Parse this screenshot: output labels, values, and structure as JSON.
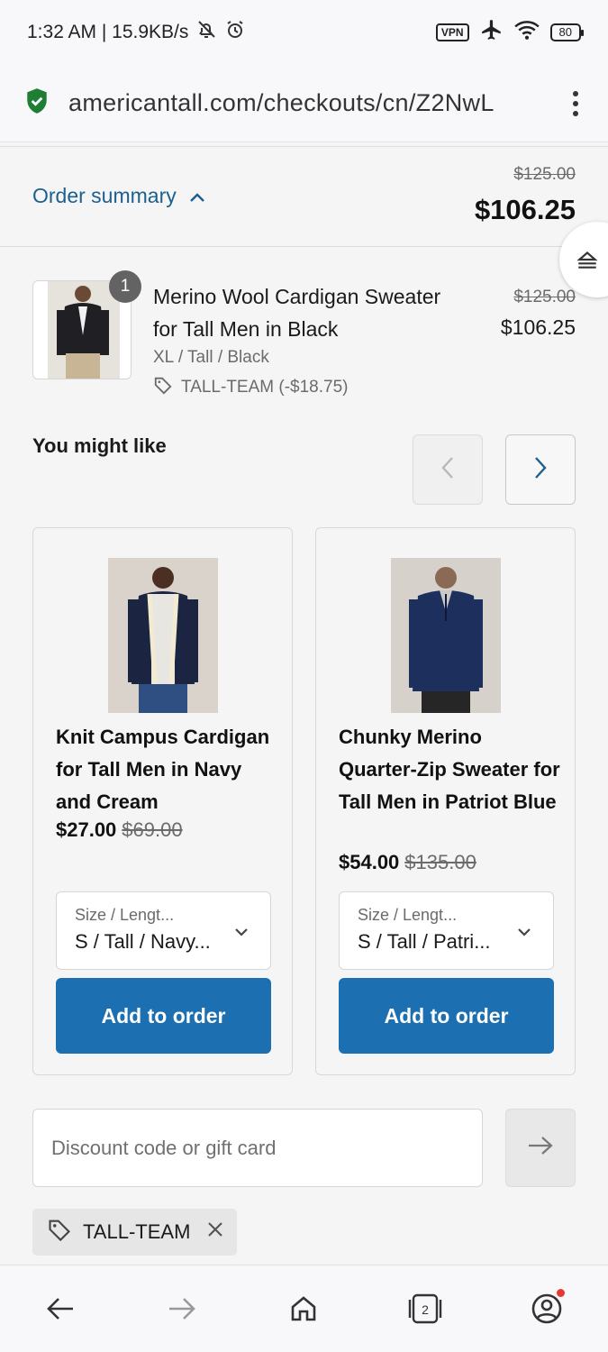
{
  "status_bar": {
    "time_speed": "1:32 AM | 15.9KB/s",
    "vpn": "VPN",
    "battery": "80"
  },
  "browser": {
    "url": "americantall.com/checkouts/cn/Z2NwL"
  },
  "summary": {
    "toggle_label": "Order summary",
    "original_total": "$125.00",
    "total": "$106.25"
  },
  "line_item": {
    "quantity": "1",
    "title": "Merino Wool Cardigan Sweater for Tall Men in Black",
    "variant": "XL / Tall / Black",
    "discount": "TALL-TEAM (-$18.75)",
    "original_price": "$125.00",
    "price": "$106.25"
  },
  "recommendations": {
    "title": "You might like",
    "items": [
      {
        "title": "Knit Campus Cardigan for Tall Men in Navy and Cream",
        "price": "$27.00",
        "original_price": "$69.00",
        "select_label": "Size / Lengt...",
        "select_value": "S / Tall / Navy...",
        "button": "Add to order"
      },
      {
        "title": "Chunky Merino Quarter-Zip Sweater for Tall Men in Patriot Blue",
        "price": "$54.00",
        "original_price": "$135.00",
        "select_label": "Size / Lengt...",
        "select_value": "S / Tall / Patri...",
        "button": "Add to order"
      }
    ]
  },
  "discount": {
    "placeholder": "Discount code or gift card",
    "applied_code": "TALL-TEAM"
  },
  "colors": {
    "accent": "#1c6fb1",
    "link": "#1d5f8f",
    "secure": "#1e7e34"
  },
  "icons": [
    "bell-off-icon",
    "alarm-icon",
    "airplane-icon",
    "wifi-icon",
    "shield-check-icon",
    "menu-kebab-icon",
    "chevron-up-icon",
    "collapse-icon",
    "tag-icon",
    "chevron-left-icon",
    "chevron-right-icon",
    "chevron-down-icon",
    "arrow-right-icon",
    "close-icon",
    "back-icon",
    "forward-icon",
    "home-icon",
    "tabs-icon",
    "account-icon"
  ]
}
